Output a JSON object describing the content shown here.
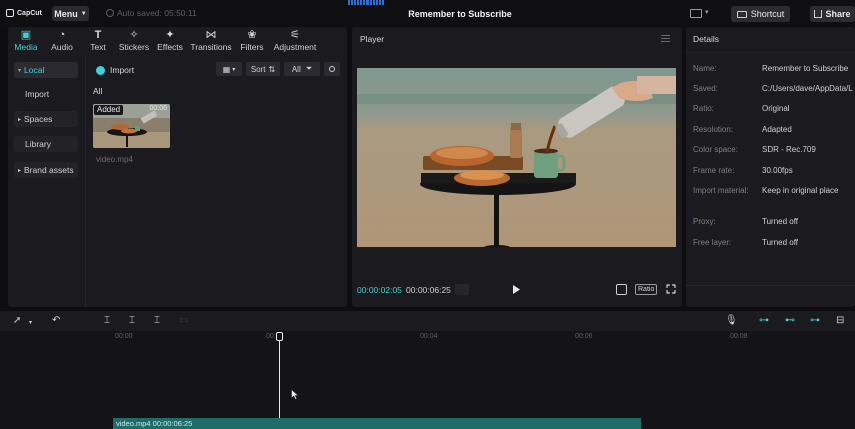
{
  "topbar": {
    "logo": "CapCut",
    "menu_label": "Menu",
    "autosave_text": "Auto saved: 05:50:11",
    "project_title": "Remember to Subscribe",
    "shortcut_label": "Shortcut",
    "share_label": "Share"
  },
  "tabs": [
    {
      "label": "Media",
      "icon": "media-icon"
    },
    {
      "label": "Audio",
      "icon": "audio-icon"
    },
    {
      "label": "Text",
      "icon": "text-icon"
    },
    {
      "label": "Stickers",
      "icon": "stickers-icon"
    },
    {
      "label": "Effects",
      "icon": "effects-icon"
    },
    {
      "label": "Transitions",
      "icon": "transitions-icon"
    },
    {
      "label": "Filters",
      "icon": "filters-icon"
    },
    {
      "label": "Adjustment",
      "icon": "adjustment-icon"
    }
  ],
  "sidenav": {
    "local": "Local",
    "import": "Import",
    "spaces": "Spaces",
    "library": "Library",
    "brand_assets": "Brand assets"
  },
  "media": {
    "import_label": "Import",
    "sort_label": "Sort",
    "filter_label": "All",
    "section_label": "All",
    "item": {
      "badge": "Added",
      "duration": "00:06",
      "name": "video.mp4"
    }
  },
  "player": {
    "title": "Player",
    "time_current": "00:00:02:05",
    "time_total": "00:00:06:25",
    "ratio_label": "Ratio"
  },
  "details": {
    "title": "Details",
    "rows": [
      {
        "label": "Name:",
        "value": "Remember to Subscribe"
      },
      {
        "label": "Saved:",
        "value": "C:/Users/dave/AppData/L"
      },
      {
        "label": "Ratio:",
        "value": "Original"
      },
      {
        "label": "Resolution:",
        "value": "Adapted"
      },
      {
        "label": "Color space:",
        "value": "SDR - Rec.709"
      },
      {
        "label": "Frame rate:",
        "value": "30.00fps"
      },
      {
        "label": "Import material:",
        "value": "Keep in original place"
      },
      {
        "label": "Proxy:",
        "value": "Turned off"
      },
      {
        "label": "Free layer:",
        "value": "Turned off"
      }
    ]
  },
  "timeline": {
    "ticks": [
      "00:00",
      "00:02",
      "00:04",
      "00:06",
      "00:08"
    ],
    "clip_label": "video.mp4  00:00:06:25"
  },
  "colors": {
    "accent": "#3fd1d7",
    "clip": "#1e6d6b"
  }
}
